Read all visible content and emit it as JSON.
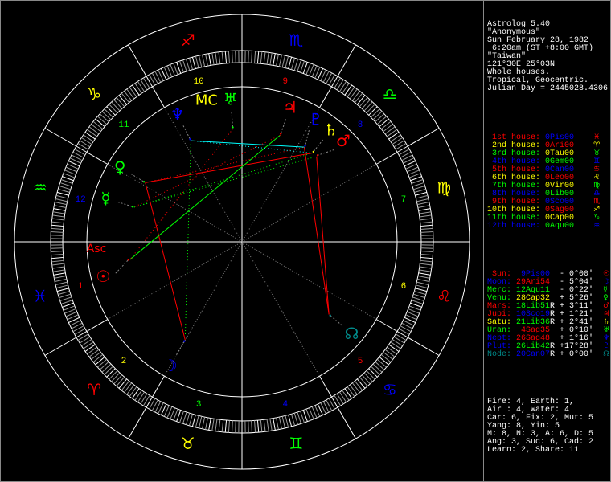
{
  "header": [
    "Astrolog 5.40",
    "\"Anonymous\"",
    "Sun February 28, 1982",
    " 6:20am (ST +8:00 GMT)",
    "\"Taiwan\"",
    "121°30E 25°03N",
    "Whole houses.",
    "Tropical, Geocentric.",
    "Julian Day = 2445028.4306"
  ],
  "colors": {
    "fire": "#ff0000",
    "earth": "#ffff00",
    "air": "#00ff00",
    "water": "#0000ff",
    "teal": "#008b8b",
    "white": "#ffffff",
    "gray": "#888888",
    "cyan": "#00ffff"
  },
  "houses": [
    {
      "label": "1st house:",
      "cusp": "0Pis00",
      "glyph": "♓",
      "lc": "fire",
      "cc": "water",
      "gc": "fire"
    },
    {
      "label": "2nd house:",
      "cusp": "0Ari00",
      "glyph": "♈",
      "lc": "earth",
      "cc": "fire",
      "gc": "earth"
    },
    {
      "label": "3rd house:",
      "cusp": "0Tau00",
      "glyph": "♉",
      "lc": "air",
      "cc": "earth",
      "gc": "air"
    },
    {
      "label": "4th house:",
      "cusp": "0Gem00",
      "glyph": "♊",
      "lc": "water",
      "cc": "air",
      "gc": "water"
    },
    {
      "label": "5th house:",
      "cusp": "0Can00",
      "glyph": "♋",
      "lc": "fire",
      "cc": "water",
      "gc": "fire"
    },
    {
      "label": "6th house:",
      "cusp": "0Leo00",
      "glyph": "♌",
      "lc": "earth",
      "cc": "fire",
      "gc": "earth"
    },
    {
      "label": "7th house:",
      "cusp": "0Vir00",
      "glyph": "♍",
      "lc": "air",
      "cc": "earth",
      "gc": "air"
    },
    {
      "label": "8th house:",
      "cusp": "0Lib00",
      "glyph": "♎",
      "lc": "water",
      "cc": "air",
      "gc": "water"
    },
    {
      "label": "9th house:",
      "cusp": "0Sco00",
      "glyph": "♏",
      "lc": "fire",
      "cc": "water",
      "gc": "fire"
    },
    {
      "label": "10th house:",
      "cusp": "0Sag00",
      "glyph": "♐",
      "lc": "earth",
      "cc": "fire",
      "gc": "earth"
    },
    {
      "label": "11th house:",
      "cusp": "0Cap00",
      "glyph": "♑",
      "lc": "air",
      "cc": "earth",
      "gc": "air"
    },
    {
      "label": "12th house:",
      "cusp": "0Aqu00",
      "glyph": "♒",
      "lc": "water",
      "cc": "air",
      "gc": "water"
    }
  ],
  "planets": [
    {
      "label": " Sun:",
      "pos": "  9Pis00",
      "retro": " ",
      "delta": " - 0°00'",
      "glyph": "☉",
      "lc": "fire",
      "pc": "water",
      "lon": 339.0
    },
    {
      "label": "Moon:",
      "pos": " 29Ari54",
      "retro": " ",
      "delta": " - 5°04'",
      "glyph": "☽",
      "lc": "water",
      "pc": "fire",
      "lon": 29.9
    },
    {
      "label": "Merc:",
      "pos": " 12Aqu11",
      "retro": " ",
      "delta": " - 0°22'",
      "glyph": "☿",
      "lc": "air",
      "pc": "air",
      "lon": 312.2
    },
    {
      "label": "Venu:",
      "pos": " 28Cap32",
      "retro": " ",
      "delta": " + 5°26'",
      "glyph": "♀",
      "lc": "air",
      "pc": "earth",
      "lon": 298.5
    },
    {
      "label": "Mars:",
      "pos": " 18Lib51",
      "retro": "R",
      "delta": " + 3°11'",
      "glyph": "♂",
      "lc": "fire",
      "pc": "air",
      "lon": 198.85
    },
    {
      "label": "Jupi:",
      "pos": " 10Sco19",
      "retro": "R",
      "delta": " + 1°21'",
      "glyph": "♃",
      "lc": "fire",
      "pc": "water",
      "lon": 220.3
    },
    {
      "label": "Satu:",
      "pos": " 21Lib36",
      "retro": "R",
      "delta": " + 2°41'",
      "glyph": "♄",
      "lc": "earth",
      "pc": "air",
      "lon": 201.6
    },
    {
      "label": "Uran:",
      "pos": "  4Sag35",
      "retro": " ",
      "delta": " + 0°10'",
      "glyph": "♅",
      "lc": "air",
      "pc": "fire",
      "lon": 244.6
    },
    {
      "label": "Nept:",
      "pos": " 26Sag48",
      "retro": " ",
      "delta": " + 1°16'",
      "glyph": "♆",
      "lc": "water",
      "pc": "fire",
      "lon": 266.8
    },
    {
      "label": "Plut:",
      "pos": " 26Lib42",
      "retro": "R",
      "delta": " +17°28'",
      "glyph": "♇",
      "lc": "water",
      "pc": "air",
      "lon": 206.7
    },
    {
      "label": "Node:",
      "pos": " 20Can07",
      "retro": "R",
      "delta": " + 0°00'",
      "glyph": "☊",
      "lc": "teal",
      "pc": "water",
      "lon": 110.1
    }
  ],
  "summary": [
    "Fire: 4, Earth: 1,",
    "Air : 4, Water: 4",
    "Car: 6, Fix: 2, Mut: 5",
    "Yang: 8, Yin: 5",
    "M: 8, N: 3, A: 6, D: 5",
    "Ang: 3, Suc: 6, Cad: 2",
    "Learn: 2, Share: 11"
  ],
  "wheel": {
    "signs": [
      {
        "glyph": "♈",
        "c": "fire"
      },
      {
        "glyph": "♉",
        "c": "earth"
      },
      {
        "glyph": "♊",
        "c": "air"
      },
      {
        "glyph": "♋",
        "c": "water"
      },
      {
        "glyph": "♌",
        "c": "fire"
      },
      {
        "glyph": "♍",
        "c": "earth"
      },
      {
        "glyph": "♎",
        "c": "air"
      },
      {
        "glyph": "♏",
        "c": "water"
      },
      {
        "glyph": "♐",
        "c": "fire"
      },
      {
        "glyph": "♑",
        "c": "earth"
      },
      {
        "glyph": "♒",
        "c": "air"
      },
      {
        "glyph": "♓",
        "c": "water"
      }
    ],
    "first_cusp": 330,
    "house_numbers": [
      "1",
      "2",
      "3",
      "4",
      "5",
      "6",
      "7",
      "8",
      "9",
      "10",
      "11",
      "12"
    ],
    "house_colors": [
      "fire",
      "earth",
      "air",
      "water",
      "fire",
      "earth",
      "air",
      "water",
      "fire",
      "earth",
      "air",
      "water"
    ],
    "asc": {
      "label": "Asc",
      "lon": 336,
      "c": "fire"
    },
    "mc": {
      "label": "MC",
      "lon": 254,
      "c": "earth"
    },
    "aspects": [
      {
        "a": 3,
        "b": 1,
        "type": "square",
        "c": "fire",
        "style": "solid"
      },
      {
        "a": 3,
        "b": 6,
        "type": "square",
        "c": "fire",
        "style": "solid"
      },
      {
        "a": 3,
        "b": 9,
        "type": "square",
        "c": "fire",
        "style": "dotted"
      },
      {
        "a": 4,
        "b": 10,
        "type": "square",
        "c": "fire",
        "style": "solid"
      },
      {
        "a": 9,
        "b": 10,
        "type": "square",
        "c": "fire",
        "style": "solid"
      },
      {
        "a": 0,
        "b": 5,
        "type": "trine",
        "c": "air",
        "style": "solid"
      },
      {
        "a": 2,
        "b": 4,
        "type": "trine",
        "c": "air",
        "style": "dotted"
      },
      {
        "a": 2,
        "b": 6,
        "type": "trine",
        "c": "air",
        "style": "dotted"
      },
      {
        "a": 8,
        "b": 1,
        "type": "trine",
        "c": "air",
        "style": "dotted"
      },
      {
        "a": 8,
        "b": 9,
        "type": "sextile",
        "c": "cyan",
        "style": "solid"
      },
      {
        "a": 8,
        "b": 6,
        "type": "sextile",
        "c": "cyan",
        "style": "dotted"
      },
      {
        "a": 5,
        "b": 2,
        "type": "square",
        "c": "fire",
        "style": "dotted"
      },
      {
        "a": 7,
        "b": 0,
        "type": "square",
        "c": "fire",
        "style": "dotted"
      }
    ]
  }
}
